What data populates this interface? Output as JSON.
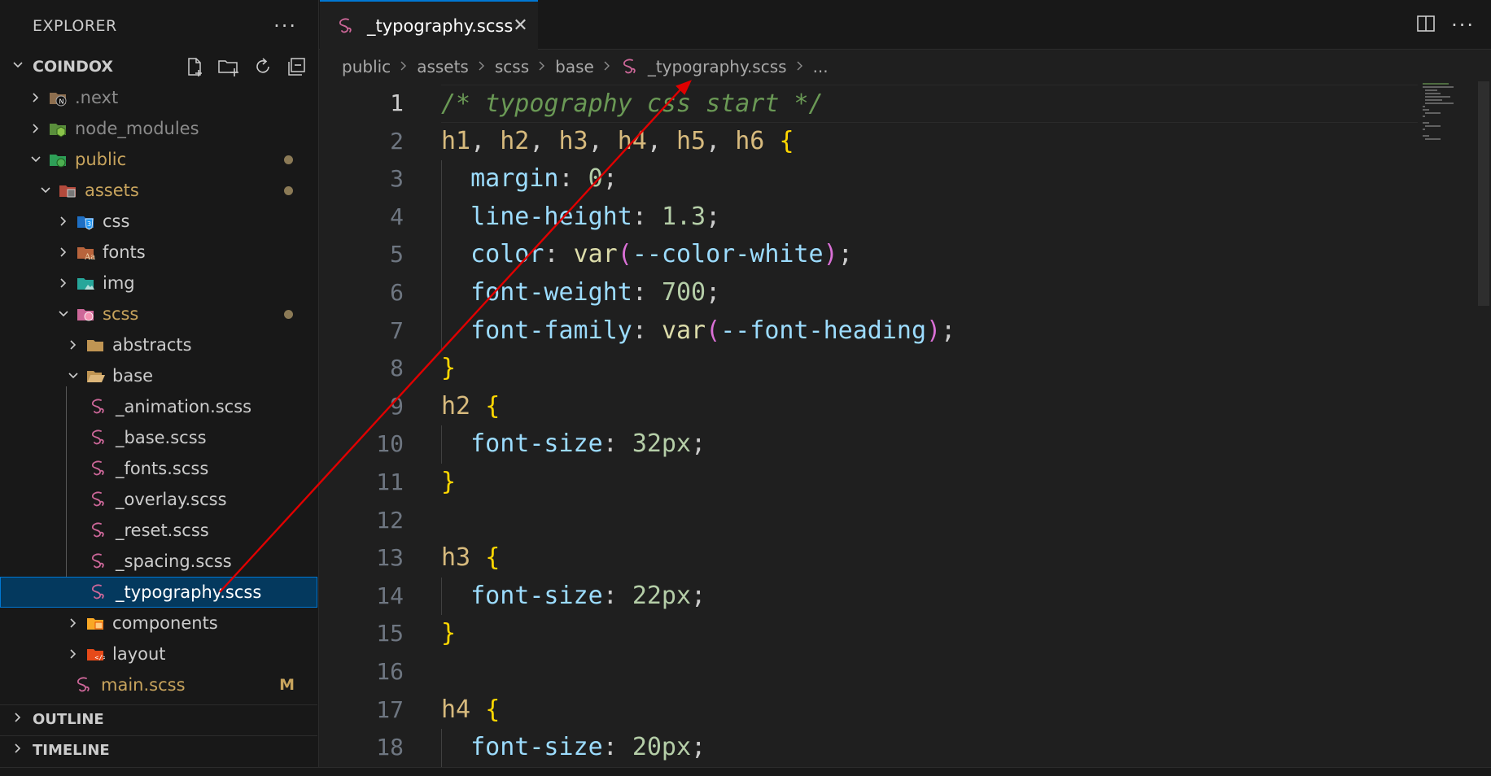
{
  "explorer": {
    "title": "EXPLORER",
    "more_label": "···",
    "root": "COINDOX"
  },
  "tree": [
    {
      "label": ".next",
      "depth": 0,
      "chevron": "closed",
      "icon": "next-folder-icon",
      "color": "#8b8b8b",
      "badge": ""
    },
    {
      "label": "node_modules",
      "depth": 0,
      "chevron": "closed",
      "icon": "node-folder-icon",
      "color": "#8b8b8b",
      "badge": ""
    },
    {
      "label": "public",
      "depth": 0,
      "chevron": "open",
      "icon": "public-folder-icon",
      "color": "#c8a45d",
      "badge": "dot"
    },
    {
      "label": "assets",
      "depth": 1,
      "chevron": "open",
      "icon": "assets-folder-icon",
      "color": "#c8a45d",
      "badge": "dot"
    },
    {
      "label": "css",
      "depth": 2,
      "chevron": "closed",
      "icon": "css-folder-icon",
      "color": "#cccccc",
      "badge": ""
    },
    {
      "label": "fonts",
      "depth": 2,
      "chevron": "closed",
      "icon": "fonts-folder-icon",
      "color": "#cccccc",
      "badge": ""
    },
    {
      "label": "img",
      "depth": 2,
      "chevron": "closed",
      "icon": "img-folder-icon",
      "color": "#cccccc",
      "badge": ""
    },
    {
      "label": "scss",
      "depth": 2,
      "chevron": "open",
      "icon": "sass-folder-icon",
      "color": "#c8a45d",
      "badge": "dot"
    },
    {
      "label": "abstracts",
      "depth": 3,
      "chevron": "closed",
      "icon": "folder-icon",
      "color": "#cccccc",
      "badge": ""
    },
    {
      "label": "base",
      "depth": 3,
      "chevron": "open",
      "icon": "folder-open-icon",
      "color": "#cccccc",
      "badge": ""
    },
    {
      "label": "_animation.scss",
      "depth": 4,
      "chevron": "none",
      "icon": "sass-file-icon",
      "color": "#cccccc",
      "badge": ""
    },
    {
      "label": "_base.scss",
      "depth": 4,
      "chevron": "none",
      "icon": "sass-file-icon",
      "color": "#cccccc",
      "badge": ""
    },
    {
      "label": "_fonts.scss",
      "depth": 4,
      "chevron": "none",
      "icon": "sass-file-icon",
      "color": "#cccccc",
      "badge": ""
    },
    {
      "label": "_overlay.scss",
      "depth": 4,
      "chevron": "none",
      "icon": "sass-file-icon",
      "color": "#cccccc",
      "badge": ""
    },
    {
      "label": "_reset.scss",
      "depth": 4,
      "chevron": "none",
      "icon": "sass-file-icon",
      "color": "#cccccc",
      "badge": ""
    },
    {
      "label": "_spacing.scss",
      "depth": 4,
      "chevron": "none",
      "icon": "sass-file-icon",
      "color": "#cccccc",
      "badge": ""
    },
    {
      "label": "_typography.scss",
      "depth": 4,
      "chevron": "none",
      "icon": "sass-file-icon",
      "color": "#ffffff",
      "badge": "",
      "selected": true
    },
    {
      "label": "components",
      "depth": 3,
      "chevron": "closed",
      "icon": "components-folder-icon",
      "color": "#cccccc",
      "badge": ""
    },
    {
      "label": "layout",
      "depth": 3,
      "chevron": "closed",
      "icon": "layout-folder-icon",
      "color": "#cccccc",
      "badge": ""
    },
    {
      "label": "main.scss",
      "depth": 3,
      "chevron": "none",
      "icon": "sass-file-icon",
      "color": "#c8a45d",
      "badge": "M"
    }
  ],
  "sections": {
    "outline": "OUTLINE",
    "timeline": "TIMELINE"
  },
  "tab": {
    "label": "_typography.scss",
    "close": "✕"
  },
  "breadcrumb": [
    "public",
    "assets",
    "scss",
    "base",
    "_typography.scss",
    "..."
  ],
  "code": [
    [
      [
        "cm",
        "/* typography css start */"
      ]
    ],
    [
      [
        "sel",
        "h1"
      ],
      [
        "t",
        ", "
      ],
      [
        "sel",
        "h2"
      ],
      [
        "t",
        ", "
      ],
      [
        "sel",
        "h3"
      ],
      [
        "t",
        ", "
      ],
      [
        "sel",
        "h4"
      ],
      [
        "t",
        ", "
      ],
      [
        "sel",
        "h5"
      ],
      [
        "t",
        ", "
      ],
      [
        "sel",
        "h6"
      ],
      [
        "t",
        " "
      ],
      [
        "b1",
        "{"
      ]
    ],
    [
      [
        "t",
        "  "
      ],
      [
        "p",
        "margin"
      ],
      [
        "t",
        ": "
      ],
      [
        "n",
        "0"
      ],
      [
        "t",
        ";"
      ]
    ],
    [
      [
        "t",
        "  "
      ],
      [
        "p",
        "line-height"
      ],
      [
        "t",
        ": "
      ],
      [
        "n",
        "1.3"
      ],
      [
        "t",
        ";"
      ]
    ],
    [
      [
        "t",
        "  "
      ],
      [
        "p",
        "color"
      ],
      [
        "t",
        ": "
      ],
      [
        "f",
        "var"
      ],
      [
        "b2",
        "("
      ],
      [
        "v",
        "--color-white"
      ],
      [
        "b2",
        ")"
      ],
      [
        "t",
        ";"
      ]
    ],
    [
      [
        "t",
        "  "
      ],
      [
        "p",
        "font-weight"
      ],
      [
        "t",
        ": "
      ],
      [
        "n",
        "700"
      ],
      [
        "t",
        ";"
      ]
    ],
    [
      [
        "t",
        "  "
      ],
      [
        "p",
        "font-family"
      ],
      [
        "t",
        ": "
      ],
      [
        "f",
        "var"
      ],
      [
        "b2",
        "("
      ],
      [
        "v",
        "--font-heading"
      ],
      [
        "b2",
        ")"
      ],
      [
        "t",
        ";"
      ]
    ],
    [
      [
        "b1",
        "}"
      ]
    ],
    [
      [
        "sel",
        "h2"
      ],
      [
        "t",
        " "
      ],
      [
        "b1",
        "{"
      ]
    ],
    [
      [
        "t",
        "  "
      ],
      [
        "p",
        "font-size"
      ],
      [
        "t",
        ": "
      ],
      [
        "n",
        "32px"
      ],
      [
        "t",
        ";"
      ]
    ],
    [
      [
        "b1",
        "}"
      ]
    ],
    [],
    [
      [
        "sel",
        "h3"
      ],
      [
        "t",
        " "
      ],
      [
        "b1",
        "{"
      ]
    ],
    [
      [
        "t",
        "  "
      ],
      [
        "p",
        "font-size"
      ],
      [
        "t",
        ": "
      ],
      [
        "n",
        "22px"
      ],
      [
        "t",
        ";"
      ]
    ],
    [
      [
        "b1",
        "}"
      ]
    ],
    [],
    [
      [
        "sel",
        "h4"
      ],
      [
        "t",
        " "
      ],
      [
        "b1",
        "{"
      ]
    ],
    [
      [
        "t",
        "  "
      ],
      [
        "p",
        "font-size"
      ],
      [
        "t",
        ": "
      ],
      [
        "n",
        "20px"
      ],
      [
        "t",
        ";"
      ]
    ]
  ],
  "colors": {
    "accent": "#0078d4",
    "selection": "#04395e",
    "sass": "#cd6799",
    "modified": "#c8a45d",
    "annotation_arrow": "#e00000"
  }
}
